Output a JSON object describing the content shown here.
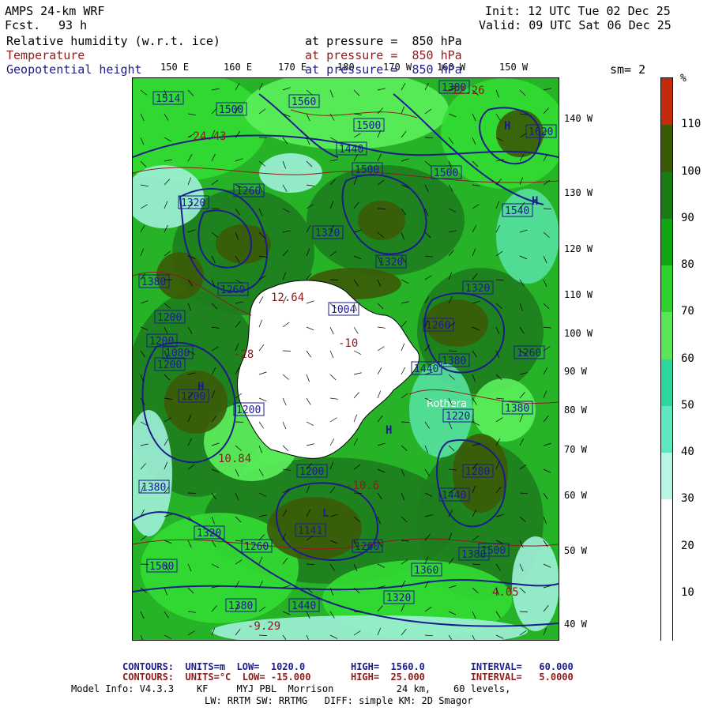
{
  "header": {
    "model": "AMPS 24-km WRF",
    "fcst_label": "Fcst.",
    "fcst_value": "93 h",
    "init": "Init: 12 UTC Tue 02 Dec 25",
    "valid": "Valid: 09 UTC Sat 06 Dec 25",
    "fields": [
      {
        "name": "Relative humidity (w.r.t. ice)",
        "level": "at pressure =  850 hPa",
        "color": "#000000"
      },
      {
        "name": "Temperature",
        "level": "at pressure =  850 hPa",
        "color": "#8c1c1c"
      },
      {
        "name": "Geopotential height",
        "level": "at pressure =  850 hPa",
        "color": "#1c1c8c"
      }
    ],
    "sm": "sm= 2"
  },
  "map": {
    "lon_labels": [
      "150 E",
      "160 E",
      "170 E",
      "180",
      "170 W",
      "160 W",
      "150 W"
    ],
    "lat_labels": [
      "140 W",
      "130 W",
      "120 W",
      "110 W",
      "100 W",
      "90 W",
      "80 W",
      "70 W",
      "60 W",
      "50 W",
      "40 W"
    ],
    "height_labels": [
      "1514",
      "1500",
      "1560",
      "1500",
      "1500",
      "1440",
      "1380",
      "1320",
      "1260",
      "1320",
      "1500",
      "1620",
      "1380",
      "1200",
      "1260",
      "1320",
      "1200",
      "1004",
      "1200",
      "1080",
      "1260",
      "1320",
      "1260",
      "1380",
      "1440",
      "1380",
      "1200",
      "1200",
      "1200",
      "1220",
      "1280",
      "1380",
      "1500",
      "1440",
      "1380",
      "1320",
      "1260",
      "1141",
      "1260",
      "1440",
      "1500",
      "1540",
      "1320",
      "1360",
      "1380"
    ],
    "temp_labels": [
      "-24.43",
      "12.64",
      "-28",
      "10.84",
      "-10.6",
      "4.05",
      "-9.29",
      "-12.26",
      "-10"
    ],
    "place_label": "Rothera",
    "colors": {
      "rh_very_dark": "#3b5a08",
      "rh_dark": "#1e7d1e",
      "rh_green": "#27b327",
      "rh_bright": "#33dc33",
      "rh_light": "#5cf05c",
      "rh_aqua": "#55e0a0",
      "rh_cyan": "#9ff0d8",
      "land_ice": "#ffffff",
      "height_contour": "#1c1c8c",
      "temp_contour": "#8c1c1c"
    }
  },
  "colorbar": {
    "unit": "%",
    "ticks": [
      "110",
      "100",
      "90",
      "80",
      "70",
      "60",
      "50",
      "40",
      "30",
      "20",
      "10"
    ],
    "levels": [
      "#c42a0e",
      "#3b5a08",
      "#1a7b14",
      "#13a614",
      "#2fd12f",
      "#5ae65a",
      "#2ed6a0",
      "#5fe8c0",
      "#b8f5e4",
      "#ffffff",
      "#ffffff",
      "#ffffff"
    ]
  },
  "footer": {
    "line1_a": "CONTOURS:  UNITS=m  LOW=  1020.0        HIGH=  1560.0        INTERVAL=   60.000",
    "line2_a": "CONTOURS:  UNITS=°C  LOW= -15.000       HIGH=  25.000        INTERVAL=   5.0000",
    "line3": "Model Info: V4.3.3    KF     MYJ PBL  Morrison           24 km,    60 levels,",
    "line4": "LW: RRTM SW: RRTMG   DIFF: simple KM: 2D Smagor"
  }
}
